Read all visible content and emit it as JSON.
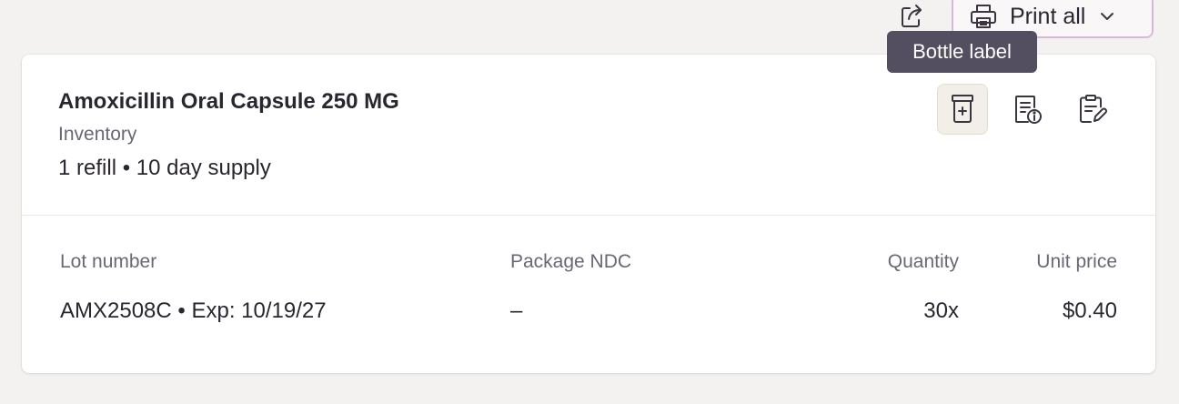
{
  "toolbar": {
    "share_icon": "share-icon",
    "print_all_label": "Print all",
    "print_icon": "printer-icon",
    "dropdown_icon": "chevron-down-icon"
  },
  "tooltip": {
    "text": "Bottle label"
  },
  "prescription": {
    "name": "Amoxicillin Oral Capsule 250 MG",
    "source": "Inventory",
    "supply": "1 refill • 10 day supply",
    "actions": [
      {
        "name": "bottle-label",
        "icon": "pill-bottle-icon",
        "active": true
      },
      {
        "name": "info-sheet",
        "icon": "document-info-icon",
        "active": false
      },
      {
        "name": "edit",
        "icon": "clipboard-edit-icon",
        "active": false
      }
    ]
  },
  "table": {
    "headers": {
      "lot": "Lot number",
      "ndc": "Package NDC",
      "quantity": "Quantity",
      "unit_price": "Unit price"
    },
    "row": {
      "lot": "AMX2508C • Exp: 10/19/27",
      "ndc": "–",
      "quantity": "30x",
      "unit_price": "$0.40"
    }
  },
  "colors": {
    "background": "#f3f2f0",
    "card": "#ffffff",
    "text": "#2a2630",
    "muted": "#6b6676",
    "tooltip_bg": "#544f60",
    "print_border": "#d9b8d6",
    "active_icon_bg": "#f2efe9"
  }
}
